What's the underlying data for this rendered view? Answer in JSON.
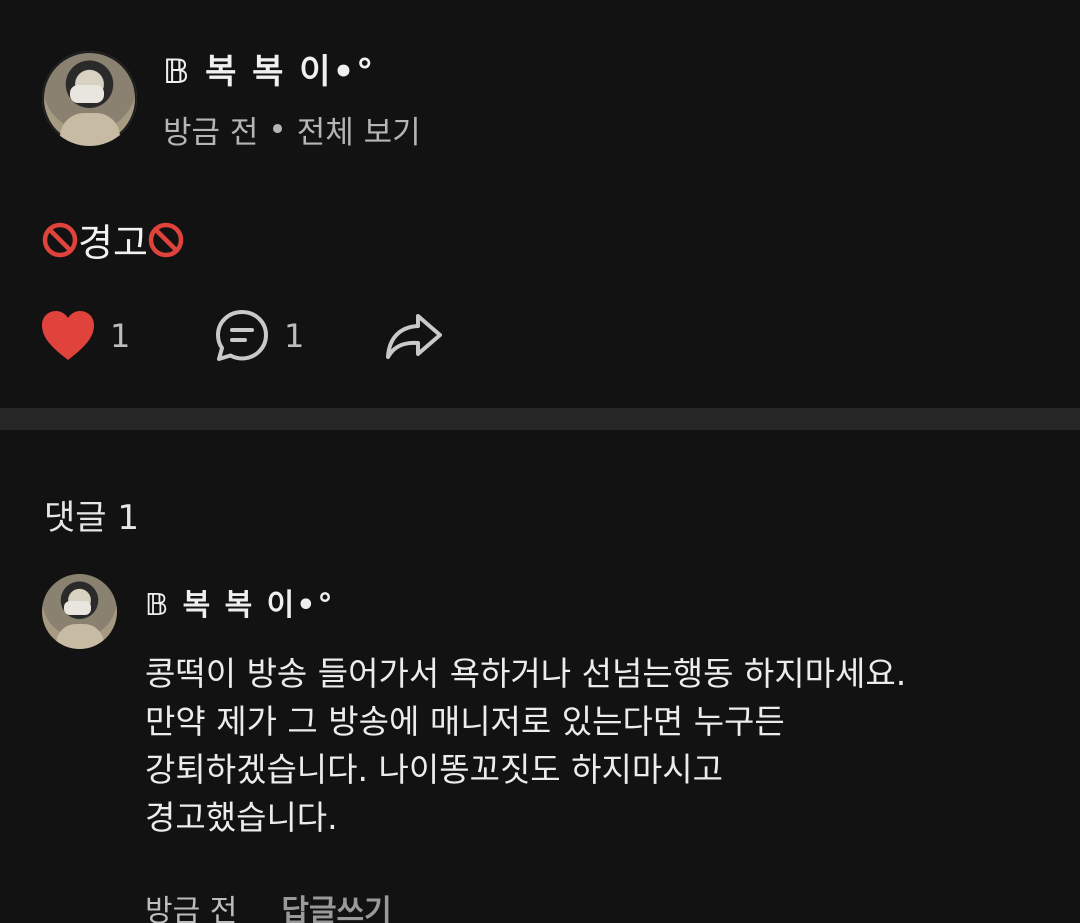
{
  "post": {
    "author": "𝔹 복 복 이•°",
    "time": "방금 전",
    "separator": "•",
    "view_all": "전체 보기",
    "body_text": "경고",
    "likes": "1",
    "comments": "1"
  },
  "comments_section": {
    "title": "댓글 1"
  },
  "comment": {
    "author": "𝔹 복 복 이•°",
    "lines": [
      "콩떡이 방송 들어가서 욕하거나 선넘는행동 하지마세요.",
      "만약 제가 그 방송에 매니저로 있는다면 누구든",
      "강퇴하겠습니다. 나이똥꼬짓도 하지마시고",
      "경고했습니다."
    ],
    "time": "방금 전",
    "reply_label": "답글쓰기"
  },
  "colors": {
    "background": "#121212",
    "heart": "#e0433c",
    "no_entry": "#e0433c",
    "divider": "#262626"
  },
  "icons": [
    "heart-icon",
    "comment-bubble-icon",
    "share-arrow-icon",
    "no-entry-icon"
  ]
}
